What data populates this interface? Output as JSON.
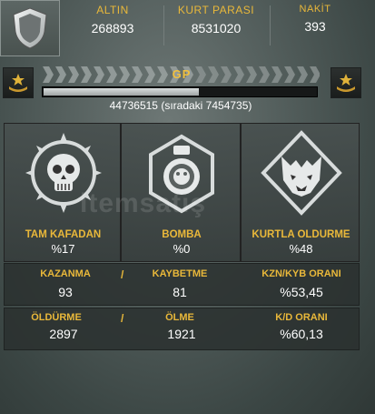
{
  "header": {
    "altin": {
      "label": "ALTIN",
      "value": "268893"
    },
    "kurt_parasi": {
      "label": "KURT PARASI",
      "value": "8531020"
    },
    "nakit": {
      "label": "NAKİT",
      "value": "393"
    }
  },
  "level": {
    "gp_label": "GP",
    "progress_fraction": 0.57,
    "xp_text": "44736515 (sıradaki 7454735)"
  },
  "medals": [
    {
      "name": "TAM KAFADAN",
      "value": "%17",
      "icon": "skull-medal-icon"
    },
    {
      "name": "BOMBA",
      "value": "%0",
      "icon": "grenade-medal-icon"
    },
    {
      "name": "KURTLA OLDURME",
      "value": "%48",
      "icon": "wolf-medal-icon"
    }
  ],
  "stats_row1": {
    "left_label": "KAZANMA",
    "left_value": "93",
    "separator": "/",
    "mid_label": "KAYBETME",
    "mid_value": "81",
    "right_label": "KZN/KYB ORANI",
    "right_value": "%53,45"
  },
  "stats_row2": {
    "left_label": "ÖLDÜRME",
    "left_value": "2897",
    "separator": "/",
    "mid_label": "ÖLME",
    "mid_value": "1921",
    "right_label": "K/D ORANI",
    "right_value": "%60,13"
  },
  "watermark": "itemsatış",
  "colors": {
    "accent": "#e9b83a",
    "panel": "#48504f",
    "text": "#ffffff"
  }
}
